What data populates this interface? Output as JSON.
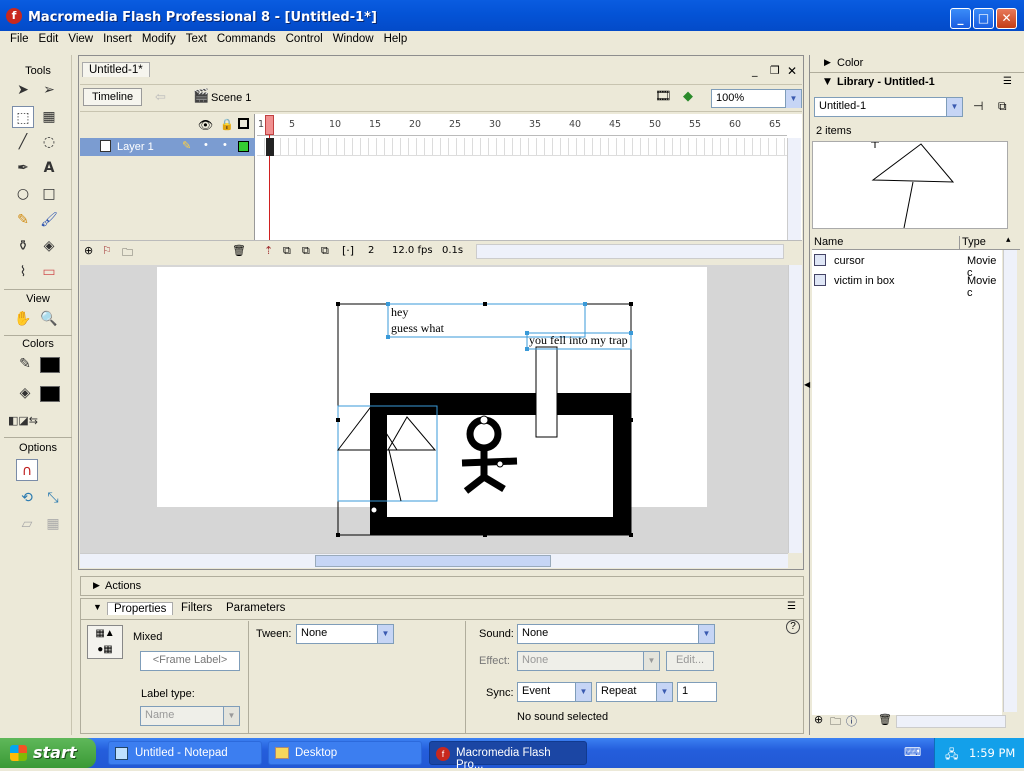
{
  "window": {
    "title": "Macromedia Flash Professional 8 - [Untitled-1*]"
  },
  "menu": [
    "File",
    "Edit",
    "View",
    "Insert",
    "Modify",
    "Text",
    "Commands",
    "Control",
    "Window",
    "Help"
  ],
  "tools": {
    "title": "Tools",
    "view_label": "View",
    "colors_label": "Colors",
    "options_label": "Options"
  },
  "document": {
    "tab": "Untitled-1*",
    "timeline_button": "Timeline",
    "scene": "Scene 1",
    "zoom": "100%"
  },
  "timeline": {
    "layer_name": "Layer 1",
    "frame_number": "2",
    "fps": "12.0 fps",
    "time": "0.1s",
    "ruler": [
      "1",
      "5",
      "10",
      "15",
      "20",
      "25",
      "30",
      "35",
      "40",
      "45",
      "50",
      "55",
      "60",
      "65"
    ]
  },
  "stage": {
    "texts": [
      "hey",
      "guess what",
      "you fell into my trap"
    ]
  },
  "actions": {
    "label": "Actions"
  },
  "properties": {
    "tabs": [
      "Properties",
      "Filters",
      "Parameters"
    ],
    "type": "Mixed",
    "frame_label_placeholder": "<Frame Label>",
    "label_type": "Label type:",
    "label_type_value": "Name",
    "tween_label": "Tween:",
    "tween_value": "None",
    "sound_label": "Sound:",
    "sound_value": "None",
    "effect_label": "Effect:",
    "effect_value": "None",
    "edit_button": "Edit...",
    "sync_label": "Sync:",
    "sync_value": "Event",
    "repeat_value": "Repeat",
    "repeat_count": "1",
    "no_sound": "No sound selected"
  },
  "color_panel": {
    "label": "Color"
  },
  "library": {
    "title": "Library - Untitled-1",
    "selector": "Untitled-1",
    "count": "2 items",
    "col_name": "Name",
    "col_type": "Type",
    "items": [
      {
        "name": "cursor",
        "type": "Movie c"
      },
      {
        "name": "victim in box",
        "type": "Movie c"
      }
    ]
  },
  "taskbar": {
    "start": "start",
    "tasks": [
      "Untitled - Notepad",
      "Desktop",
      "Macromedia Flash Pro..."
    ],
    "clock": "1:59 PM"
  }
}
